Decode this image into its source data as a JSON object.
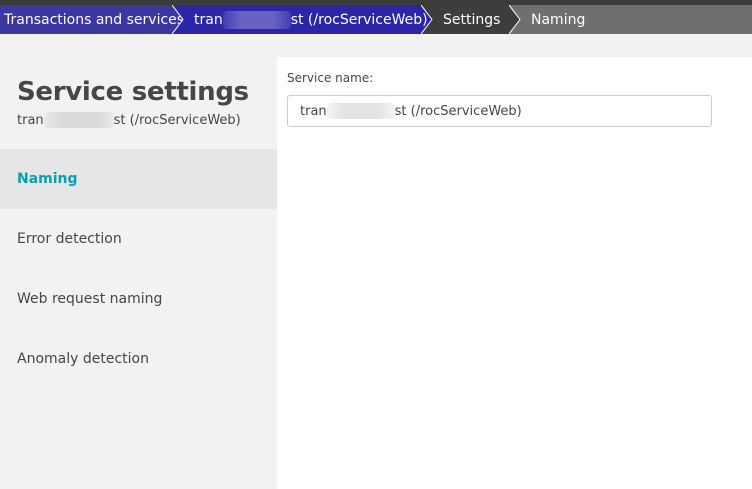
{
  "breadcrumb": {
    "items": [
      {
        "label": "Transactions and services"
      },
      {
        "label_prefix": "tran",
        "label_suffix": "st (/rocServiceWeb)"
      },
      {
        "label": "Settings"
      },
      {
        "label": "Naming"
      }
    ]
  },
  "sidebar": {
    "title": "Service settings",
    "subtitle_prefix": "tran",
    "subtitle_suffix": "st (/rocServiceWeb)",
    "items": [
      {
        "label": "Naming",
        "active": true
      },
      {
        "label": "Error detection"
      },
      {
        "label": "Web request naming"
      },
      {
        "label": "Anomaly detection"
      }
    ]
  },
  "main": {
    "service_name_label": "Service name:",
    "service_name_prefix": "tran",
    "service_name_suffix": "st (/rocServiceWeb)"
  },
  "colors": {
    "accent": "#00a1b2",
    "breadcrumb_primary": "#3c36a0",
    "breadcrumb_active": "#2c26a6",
    "breadcrumb_dark": "#3d3d3d",
    "breadcrumb_gray": "#6f6f6f"
  }
}
